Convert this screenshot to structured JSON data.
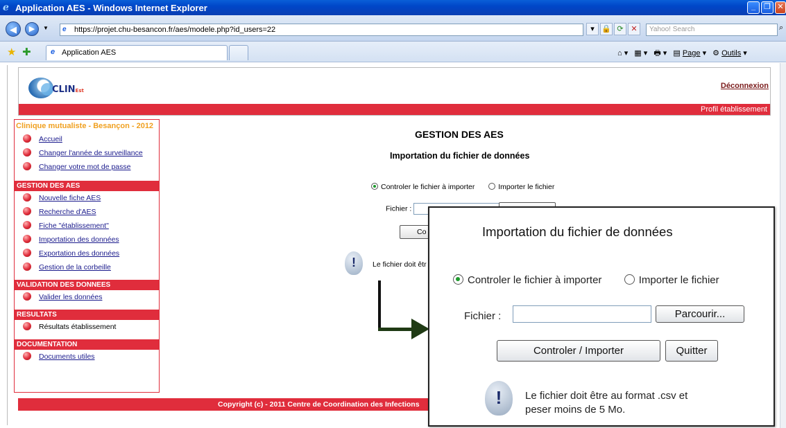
{
  "window": {
    "title": "Application AES - Windows Internet Explorer"
  },
  "addressbar": {
    "url": "https://projet.chu-besancon.fr/aes/modele.php?id_users=22",
    "search_placeholder": "Yahoo! Search"
  },
  "tabs": [
    {
      "label": "Application AES"
    }
  ],
  "commandbar": {
    "page_label": "Page",
    "tools_label": "Outils"
  },
  "header": {
    "brand": "CLIN",
    "brand_suffix": "Est",
    "logout": "Déconnexion",
    "profile": "Profil établissement"
  },
  "sidebar": {
    "establishment": "Clinique mutualiste - Besançon - 2012",
    "groups": [
      {
        "items": [
          "Accueil",
          "Changer l'année de surveillance",
          "Changer votre mot de passe"
        ]
      },
      {
        "title": "GESTION DES AES",
        "items": [
          "Nouvelle fiche AES",
          "Recherche d'AES",
          "Fiche \"établissement\"",
          "Importation des données",
          "Exportation des données",
          "Gestion de la corbeille"
        ]
      },
      {
        "title": "VALIDATION DES DONNEES",
        "items": [
          "Valider les données"
        ]
      },
      {
        "title": "RESULTATS",
        "items": [
          "Résultats établissement"
        ]
      },
      {
        "title": "DOCUMENTATION",
        "items": [
          "Documents utiles"
        ]
      }
    ]
  },
  "main": {
    "title": "GESTION DES AES",
    "subtitle": "Importation du fichier de données",
    "radio_check": "Controler le fichier à importer",
    "radio_import": "Importer le fichier",
    "file_label": "Fichier :",
    "browse_button": "Parcourir...",
    "control_button": "Controler / Importer",
    "quit_button": "Quitter",
    "info_partial": "Le fichier doit êtr"
  },
  "zoom": {
    "title": "Importation du fichier de données",
    "radio_check": "Controler le fichier à importer",
    "radio_import": "Importer le fichier",
    "file_label": "Fichier :",
    "browse_button": "Parcourir...",
    "control_button": "Controler / Importer",
    "quit_button": "Quitter",
    "info_line1": "Le fichier doit être au format .csv et",
    "info_line2": "peser moins de 5 Mo."
  },
  "footer": {
    "copyright": "Copyright (c) - 2011 Centre de Coordination des Infections"
  }
}
